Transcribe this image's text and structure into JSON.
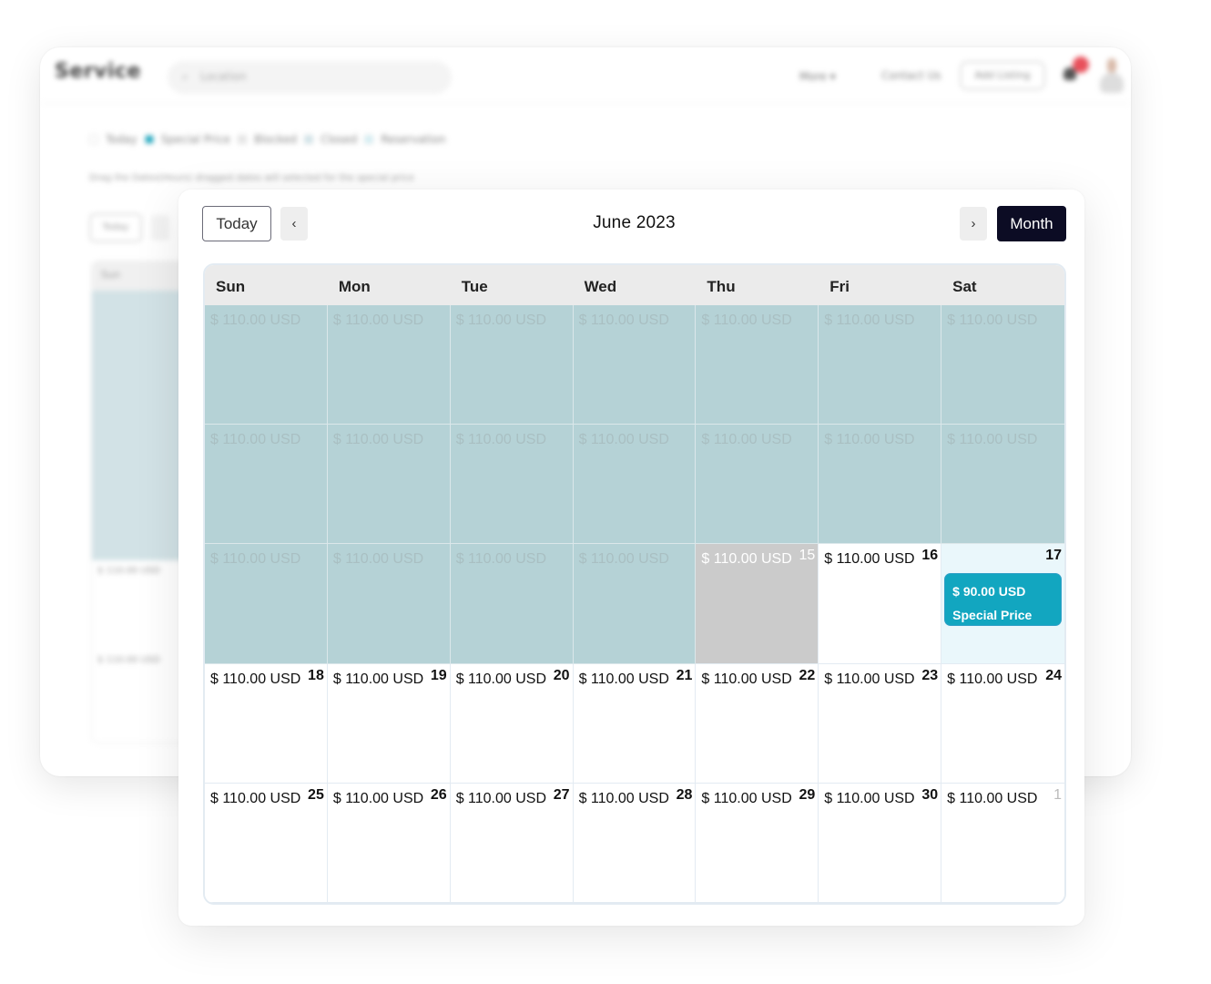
{
  "background_app": {
    "brand": "Service",
    "search": {
      "icon": "search-icon",
      "placeholder": "Location"
    },
    "nav": {
      "more_label": "More ▾",
      "contact_label": "Contact Us",
      "add_listing_label": "Add Listing"
    },
    "notification": {
      "icon": "bell-icon",
      "badge_color": "#e8505b"
    },
    "legend": [
      {
        "label": "Today",
        "color": "#ffffff"
      },
      {
        "label": "Special Price",
        "color": "#12a6c0"
      },
      {
        "label": "Blocked",
        "color": "#e6e6e6"
      },
      {
        "label": "Closed",
        "color": "#cfe4ea"
      },
      {
        "label": "Reservation",
        "color": "#d4f1f7"
      }
    ],
    "note": "Drag the Dates(Hours) dragged dates will selected for the special price",
    "today_label": "Today",
    "first_col_header": "Sun",
    "first_col_prices": [
      "$ 110.00 USD",
      "$ 110.00 USD"
    ]
  },
  "calendar": {
    "today_label": "Today",
    "prev_icon": "‹",
    "next_icon": "›",
    "title": "June 2023",
    "view_label": "Month",
    "accent_color": "#0c0c24",
    "days_of_week": [
      "Sun",
      "Mon",
      "Tue",
      "Wed",
      "Thu",
      "Fri",
      "Sat"
    ],
    "weeks": [
      [
        {
          "price": "$ 110.00 USD",
          "day": "",
          "state": "past"
        },
        {
          "price": "$ 110.00 USD",
          "day": "",
          "state": "past"
        },
        {
          "price": "$ 110.00 USD",
          "day": "",
          "state": "past"
        },
        {
          "price": "$ 110.00 USD",
          "day": "",
          "state": "past"
        },
        {
          "price": "$ 110.00 USD",
          "day": "",
          "state": "past"
        },
        {
          "price": "$ 110.00 USD",
          "day": "",
          "state": "past"
        },
        {
          "price": "$ 110.00 USD",
          "day": "",
          "state": "past"
        }
      ],
      [
        {
          "price": "$ 110.00 USD",
          "day": "",
          "state": "past"
        },
        {
          "price": "$ 110.00 USD",
          "day": "",
          "state": "past"
        },
        {
          "price": "$ 110.00 USD",
          "day": "",
          "state": "past"
        },
        {
          "price": "$ 110.00 USD",
          "day": "",
          "state": "past"
        },
        {
          "price": "$ 110.00 USD",
          "day": "",
          "state": "past"
        },
        {
          "price": "$ 110.00 USD",
          "day": "",
          "state": "past"
        },
        {
          "price": "$ 110.00 USD",
          "day": "",
          "state": "past"
        }
      ],
      [
        {
          "price": "$ 110.00 USD",
          "day": "",
          "state": "past"
        },
        {
          "price": "$ 110.00 USD",
          "day": "",
          "state": "past"
        },
        {
          "price": "$ 110.00 USD",
          "day": "",
          "state": "past"
        },
        {
          "price": "$ 110.00 USD",
          "day": "",
          "state": "past"
        },
        {
          "price": "$ 110.00 USD",
          "day": "15",
          "state": "blocked"
        },
        {
          "price": "$ 110.00 USD",
          "day": "16",
          "state": "normal"
        },
        {
          "price": "",
          "day": "17",
          "state": "today",
          "event": {
            "price": "$ 90.00 USD",
            "label": "Special Price"
          }
        }
      ],
      [
        {
          "price": "$ 110.00 USD",
          "day": "18",
          "state": "normal"
        },
        {
          "price": "$ 110.00 USD",
          "day": "19",
          "state": "normal"
        },
        {
          "price": "$ 110.00 USD",
          "day": "20",
          "state": "normal"
        },
        {
          "price": "$ 110.00 USD",
          "day": "21",
          "state": "normal"
        },
        {
          "price": "$ 110.00 USD",
          "day": "22",
          "state": "normal"
        },
        {
          "price": "$ 110.00 USD",
          "day": "23",
          "state": "normal"
        },
        {
          "price": "$ 110.00 USD",
          "day": "24",
          "state": "normal"
        }
      ],
      [
        {
          "price": "$ 110.00 USD",
          "day": "25",
          "state": "normal"
        },
        {
          "price": "$ 110.00 USD",
          "day": "26",
          "state": "normal"
        },
        {
          "price": "$ 110.00 USD",
          "day": "27",
          "state": "normal"
        },
        {
          "price": "$ 110.00 USD",
          "day": "28",
          "state": "normal"
        },
        {
          "price": "$ 110.00 USD",
          "day": "29",
          "state": "normal"
        },
        {
          "price": "$ 110.00 USD",
          "day": "30",
          "state": "normal"
        },
        {
          "price": "$ 110.00 USD",
          "day": "1",
          "state": "other-month"
        }
      ]
    ]
  }
}
